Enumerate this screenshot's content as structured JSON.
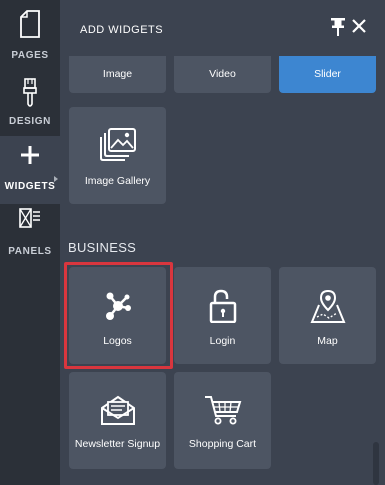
{
  "rail": {
    "items": [
      {
        "label": "PAGES",
        "icon": "page-icon"
      },
      {
        "label": "DESIGN",
        "icon": "brush-icon"
      },
      {
        "label": "WIDGETS",
        "icon": "plus-icon"
      },
      {
        "label": "PANELS",
        "icon": "panels-icon"
      }
    ],
    "active": "WIDGETS"
  },
  "panel": {
    "title": "ADD WIDGETS",
    "pin_icon": "pin-icon",
    "close_icon": "close-icon"
  },
  "widgets": {
    "media": [
      {
        "label": "Image",
        "icon": "image-icon"
      },
      {
        "label": "Video",
        "icon": "video-icon"
      },
      {
        "label": "Slider",
        "icon": "slider-icon",
        "selected": true
      },
      {
        "label": "Image Gallery",
        "icon": "image-gallery-icon"
      }
    ],
    "business": {
      "title": "BUSINESS",
      "items": [
        {
          "label": "Logos",
          "icon": "logos-icon",
          "highlighted": true
        },
        {
          "label": "Login",
          "icon": "lock-icon"
        },
        {
          "label": "Map",
          "icon": "map-icon"
        },
        {
          "label": "Newsletter Signup",
          "icon": "envelope-icon"
        },
        {
          "label": "Shopping Cart",
          "icon": "cart-icon"
        }
      ]
    }
  },
  "colors": {
    "rail_bg": "#2b3038",
    "panel_bg": "#3c4350",
    "tile_bg": "#4d5563",
    "selected_tile": "#3d86d1",
    "highlight_border": "#d9363e"
  }
}
